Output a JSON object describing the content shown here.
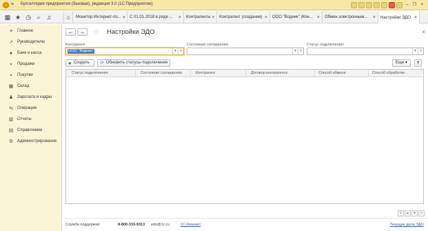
{
  "window": {
    "title": "Бухгалтерия предприятия (базовая), редакция 3.0  (1С:Предприятие)"
  },
  "tabs": [
    {
      "label": "Монитор Интернет-по..."
    },
    {
      "label": "С 01.01.2018 в ряде ..."
    },
    {
      "label": "Контрагенты"
    },
    {
      "label": "Контрагент (создание)"
    },
    {
      "label": "ООО \"Водник\" (Кон..."
    },
    {
      "label": "Обмен электронным..."
    },
    {
      "label": "Настройки ЭДО"
    }
  ],
  "tab_close": "×",
  "sidebar": {
    "items": [
      {
        "label": "Главное",
        "icon": "≡"
      },
      {
        "label": "Руководителю",
        "icon": "↗"
      },
      {
        "label": "Банк и касса",
        "icon": "●"
      },
      {
        "label": "Продажи",
        "icon": "▪"
      },
      {
        "label": "Покупки",
        "icon": "▪"
      },
      {
        "label": "Склад",
        "icon": "▦"
      },
      {
        "label": "Зарплата и кадры",
        "icon": "♟"
      },
      {
        "label": "Операции",
        "icon": "⇆"
      },
      {
        "label": "Отчеты",
        "icon": "▥"
      },
      {
        "label": "Справочники",
        "icon": "▤"
      },
      {
        "label": "Администрирование",
        "icon": "⚙"
      }
    ]
  },
  "main": {
    "title": "Настройки ЭДО",
    "filters": {
      "counterparty_label": "Контрагент",
      "counterparty_value": "ООО \"Водник\"",
      "agreement_label": "Состояние соглашения:",
      "agreement_value": "",
      "connection_label": "Статус подключения:",
      "connection_value": ""
    },
    "buttons": {
      "create": "Создать",
      "refresh": "Обновить статусы подключения",
      "more": "Еще ▾",
      "help": "?"
    },
    "table": {
      "columns": [
        "Статус подключения",
        "Состояние соглашения",
        "Контрагент",
        "Договор контрагента",
        "Способ обмена",
        "Способ обработки"
      ],
      "rows": []
    }
  },
  "footer": {
    "support_label": "Служба поддержки:",
    "phone": "8-800-333-9313",
    "email": "edo@1c.ru",
    "connect_link": "1С-Коннект",
    "current_edo_link": "Текущие дела ЭДО"
  }
}
